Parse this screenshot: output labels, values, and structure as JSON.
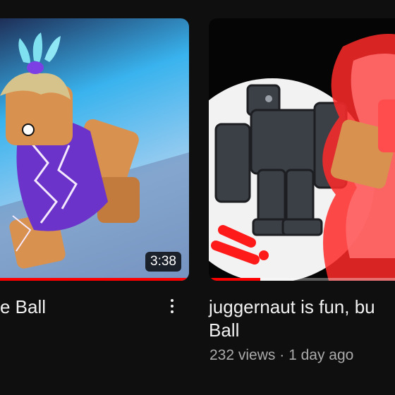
{
  "videos": [
    {
      "title_visible": "e Ball",
      "duration": "3:38",
      "watched_fraction": 1.0,
      "thumbnail": "roblox-character-lightning"
    },
    {
      "title_line1": "juggernaut is fun, bu",
      "title_line2": "Ball",
      "views": "232 views",
      "separator": "·",
      "age": "1 day ago",
      "watched_fraction": 0.25,
      "thumbnail": "roblox-juggernaut-red-aura"
    }
  ],
  "icons": {
    "more": "more-vert-icon"
  },
  "colors": {
    "background": "#0f0f0f",
    "progress": "#ff0000",
    "meta_text": "#aaaaaa"
  }
}
